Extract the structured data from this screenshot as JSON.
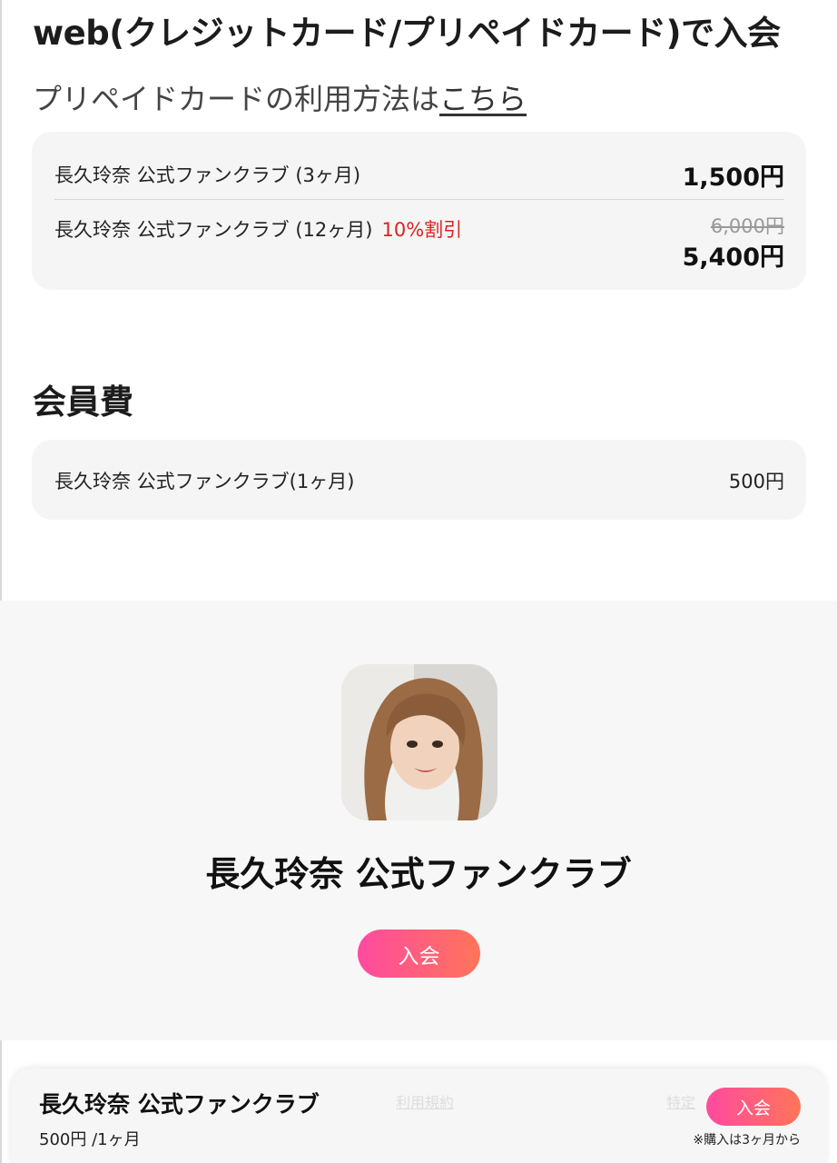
{
  "payment": {
    "title": "web(クレジットカード/プリペイドカード)で入会",
    "prepaid_text": "プリペイドカードの利用方法は",
    "prepaid_link": "こちら"
  },
  "plans": [
    {
      "name": "長久玲奈 公式ファンクラブ (3ヶ月)",
      "discount": "",
      "old_price": "",
      "price": "1,500円"
    },
    {
      "name": "長久玲奈 公式ファンクラブ (12ヶ月)",
      "discount": "10%割引",
      "old_price": "6,000円",
      "price": "5,400円"
    }
  ],
  "membership_fee": {
    "title": "会員費",
    "name": "長久玲奈 公式ファンクラブ(1ヶ月)",
    "price": "500円"
  },
  "profile": {
    "avatar": "member-photo",
    "club_name": "長久玲奈 公式ファンクラブ",
    "join_label": "入会"
  },
  "bottom_bar": {
    "club_name": "長久玲奈 公式ファンクラブ",
    "price": "500円 /1ヶ月",
    "ghost_link_1": "利用規約",
    "ghost_link_2": "特定",
    "join_label": "入会",
    "note": "※購入は3ヶ月から"
  },
  "colors": {
    "accent_gradient_start": "#ff4aa0",
    "accent_gradient_end": "#ff7558",
    "discount": "#e02020"
  }
}
